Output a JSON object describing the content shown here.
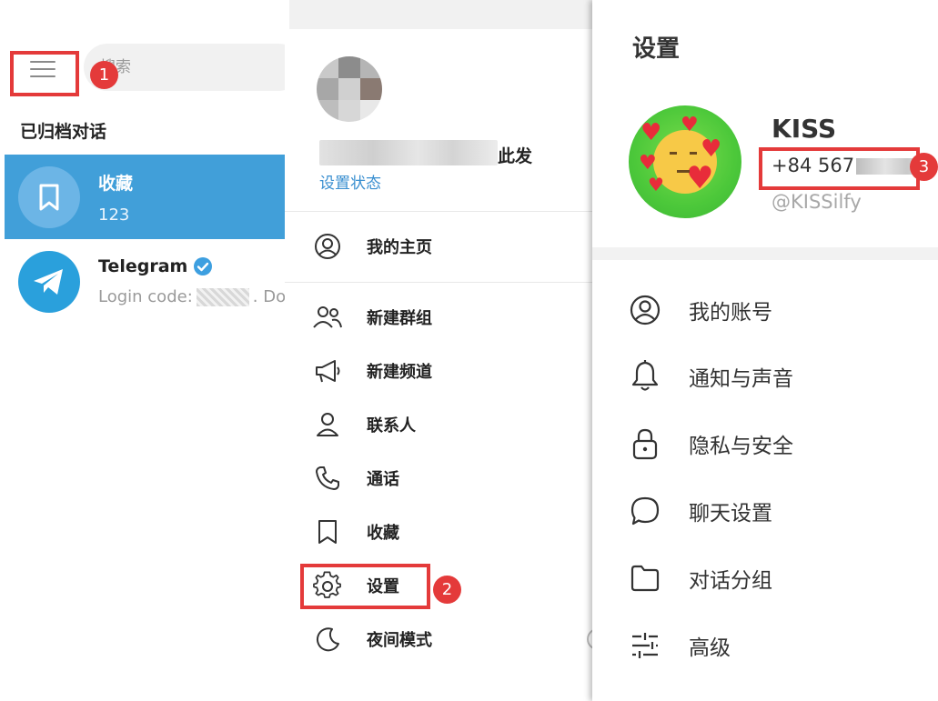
{
  "search": {
    "placeholder": "搜索"
  },
  "chat_list": {
    "section_title": "已归档对话",
    "chats": [
      {
        "name": "收藏",
        "preview": "123",
        "avatar_icon": "bookmark-icon",
        "active": true
      },
      {
        "name": "Telegram",
        "preview_prefix": "Login code:",
        "preview_suffix": ". Do n",
        "verified": true,
        "avatar_icon": "telegram-plane-icon"
      }
    ]
  },
  "main_menu": {
    "profile_name_suffix": "此发",
    "set_status": "设置状态",
    "items": [
      {
        "label": "我的主页",
        "icon": "user-circle-icon"
      },
      {
        "label": "新建群组",
        "icon": "group-icon"
      },
      {
        "label": "新建频道",
        "icon": "megaphone-icon"
      },
      {
        "label": "联系人",
        "icon": "contact-icon"
      },
      {
        "label": "通话",
        "icon": "phone-icon"
      },
      {
        "label": "收藏",
        "icon": "bookmark-icon"
      },
      {
        "label": "设置",
        "icon": "gear-icon"
      },
      {
        "label": "夜间模式",
        "icon": "moon-icon"
      }
    ]
  },
  "settings": {
    "title": "设置",
    "profile": {
      "name": "KISS",
      "phone_visible": "+84 567",
      "username": "@KISSilfy"
    },
    "items": [
      {
        "label": "我的账号",
        "icon": "user-circle-icon"
      },
      {
        "label": "通知与声音",
        "icon": "bell-icon"
      },
      {
        "label": "隐私与安全",
        "icon": "lock-icon"
      },
      {
        "label": "聊天设置",
        "icon": "chat-bubble-icon"
      },
      {
        "label": "对话分组",
        "icon": "folder-icon"
      },
      {
        "label": "高级",
        "icon": "sliders-icon"
      }
    ]
  },
  "annotations": [
    {
      "number": "1",
      "target": "menu-button"
    },
    {
      "number": "2",
      "target": "settings-menu-item"
    },
    {
      "number": "3",
      "target": "phone-number"
    }
  ],
  "colors": {
    "accent": "#419fd9",
    "annotation_red": "#e43a3a",
    "link_blue": "#3a8fd0",
    "avatar_green": "#4cc83a"
  }
}
